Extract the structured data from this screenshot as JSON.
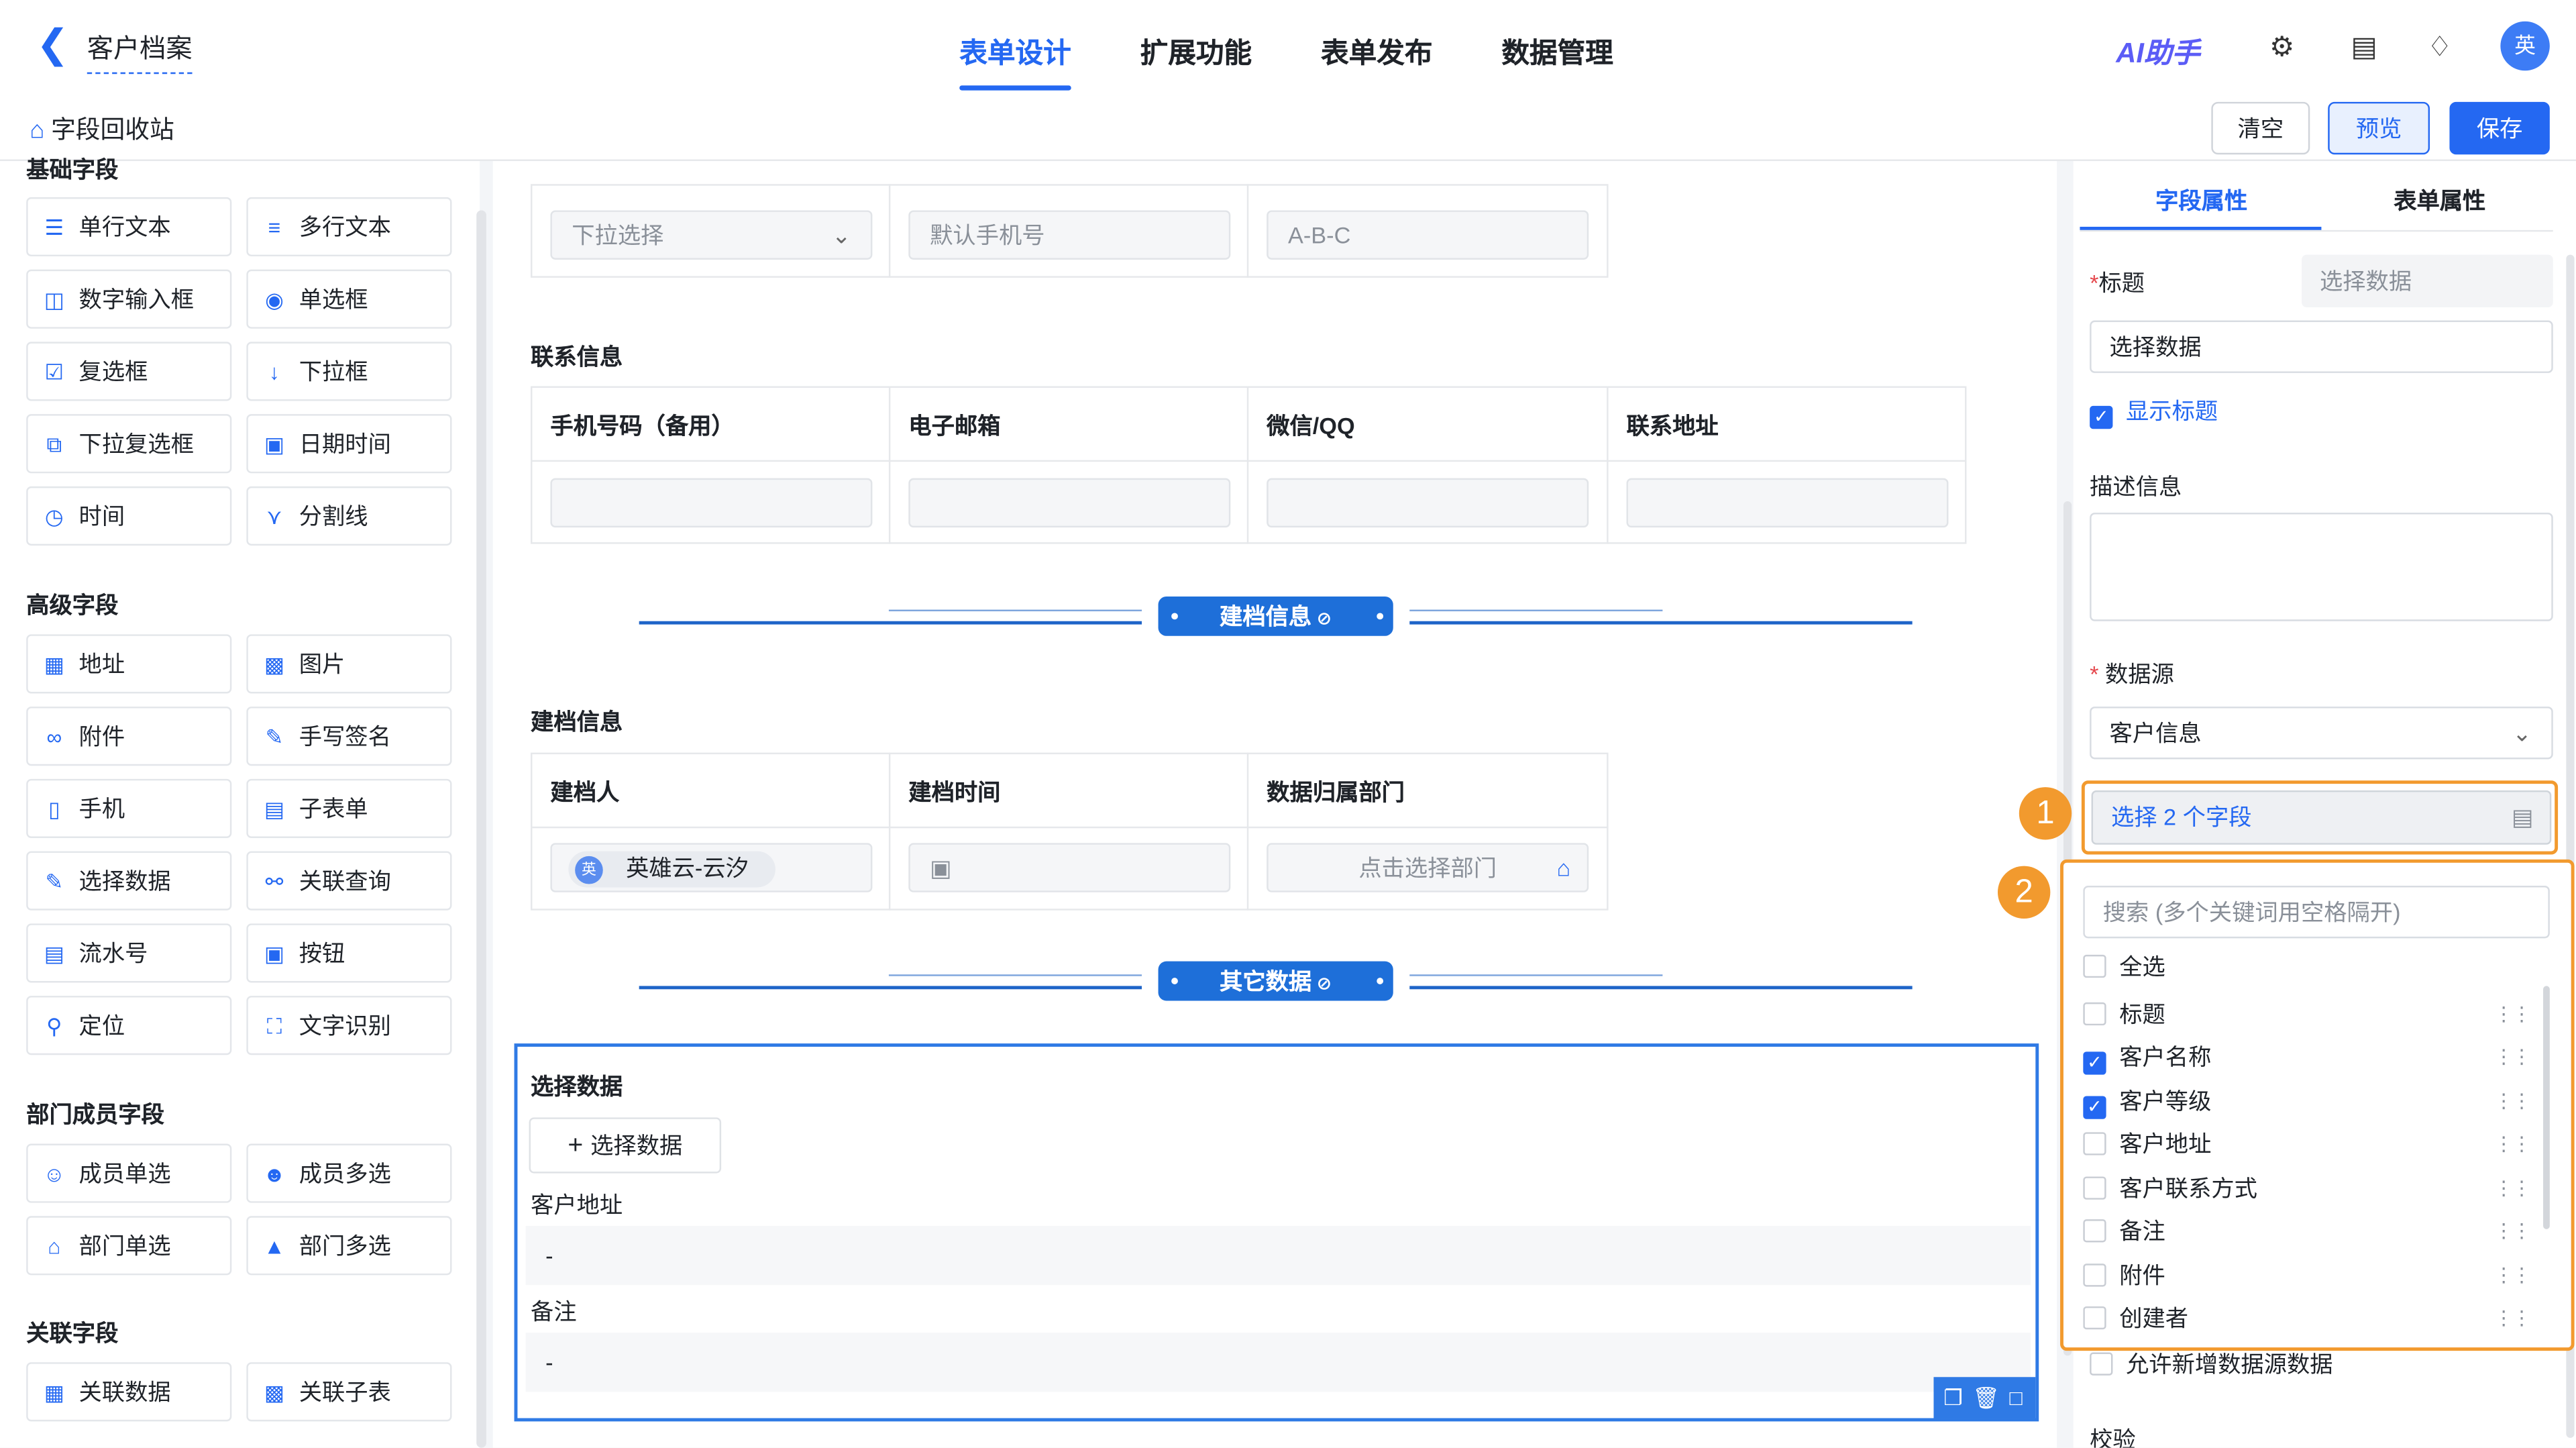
{
  "header": {
    "title": "客户档案",
    "tabs": [
      "表单设计",
      "扩展功能",
      "表单发布",
      "数据管理"
    ],
    "ai_label": "AI助手",
    "avatar_text": "英"
  },
  "toolbar": {
    "recycle_label": "字段回收站",
    "clear_label": "清空",
    "preview_label": "预览",
    "save_label": "保存"
  },
  "left_panel": {
    "basic_title": "基础字段",
    "basic": [
      {
        "label": "单行文本",
        "icon": "single-line-icon"
      },
      {
        "label": "多行文本",
        "icon": "multi-line-icon"
      },
      {
        "label": "数字输入框",
        "icon": "number-icon"
      },
      {
        "label": "单选框",
        "icon": "radio-icon"
      },
      {
        "label": "复选框",
        "icon": "checkbox-icon"
      },
      {
        "label": "下拉框",
        "icon": "dropdown-icon"
      },
      {
        "label": "下拉复选框",
        "icon": "dropdown-multi-icon"
      },
      {
        "label": "日期时间",
        "icon": "calendar-icon"
      },
      {
        "label": "时间",
        "icon": "clock-icon"
      },
      {
        "label": "分割线",
        "icon": "divider-icon"
      }
    ],
    "advanced_title": "高级字段",
    "advanced": [
      {
        "label": "地址",
        "icon": "address-icon"
      },
      {
        "label": "图片",
        "icon": "image-icon"
      },
      {
        "label": "附件",
        "icon": "attachment-icon"
      },
      {
        "label": "手写签名",
        "icon": "signature-icon"
      },
      {
        "label": "手机",
        "icon": "phone-icon"
      },
      {
        "label": "子表单",
        "icon": "subform-icon"
      },
      {
        "label": "选择数据",
        "icon": "select-data-icon"
      },
      {
        "label": "关联查询",
        "icon": "related-query-icon"
      },
      {
        "label": "流水号",
        "icon": "serial-number-icon"
      },
      {
        "label": "按钮",
        "icon": "button-icon"
      },
      {
        "label": "定位",
        "icon": "location-icon"
      },
      {
        "label": "文字识别",
        "icon": "ocr-icon"
      }
    ],
    "member_title": "部门成员字段",
    "member": [
      {
        "label": "成员单选",
        "icon": "member-single-icon"
      },
      {
        "label": "成员多选",
        "icon": "member-multi-icon"
      },
      {
        "label": "部门单选",
        "icon": "dept-single-icon"
      },
      {
        "label": "部门多选",
        "icon": "dept-multi-icon"
      }
    ],
    "related_title": "关联字段",
    "related": [
      {
        "label": "关联数据",
        "icon": "related-data-icon"
      },
      {
        "label": "关联子表",
        "icon": "related-subtable-icon"
      }
    ]
  },
  "canvas": {
    "top_row": {
      "dropdown_placeholder": "下拉选择",
      "phone_placeholder": "默认手机号",
      "abc_placeholder": "A-B-C"
    },
    "contact": {
      "title": "联系信息",
      "columns": [
        "手机号码（备用）",
        "电子邮箱",
        "微信/QQ",
        "联系地址"
      ]
    },
    "divider1": "建档信息",
    "filing": {
      "title": "建档信息",
      "columns": [
        "建档人",
        "建档时间",
        "数据归属部门"
      ],
      "creator": "英雄云-云汐",
      "creator_avatar": "英",
      "dept_placeholder": "点击选择部门"
    },
    "divider2": "其它数据",
    "select_block": {
      "title": "选择数据",
      "add_button": "选择数据",
      "fields": [
        {
          "label": "客户地址",
          "value": "-"
        },
        {
          "label": "备注",
          "value": "-"
        }
      ]
    }
  },
  "right_panel": {
    "tabs": [
      "字段属性",
      "表单属性"
    ],
    "title_label": "标题",
    "title_hint": "选择数据",
    "title_value": "选择数据",
    "show_title_label": "显示标题",
    "desc_label": "描述信息",
    "datasource_label": "数据源",
    "datasource_value": "客户信息",
    "select_fields_text": "选择  2 个字段",
    "search_placeholder": "搜索 (多个关键词用空格隔开)",
    "select_all_label": "全选",
    "options": [
      {
        "label": "标题",
        "checked": false
      },
      {
        "label": "客户名称",
        "checked": true
      },
      {
        "label": "客户等级",
        "checked": true
      },
      {
        "label": "客户地址",
        "checked": false
      },
      {
        "label": "客户联系方式",
        "checked": false
      },
      {
        "label": "备注",
        "checked": false
      },
      {
        "label": "附件",
        "checked": false
      },
      {
        "label": "创建者",
        "checked": false
      }
    ],
    "allow_add_label": "允许新增数据源数据",
    "cut_label": "校验"
  },
  "annotations": [
    "1",
    "2"
  ],
  "colors": {
    "accent": "#2468f2",
    "highlight": "#f29a2e"
  }
}
